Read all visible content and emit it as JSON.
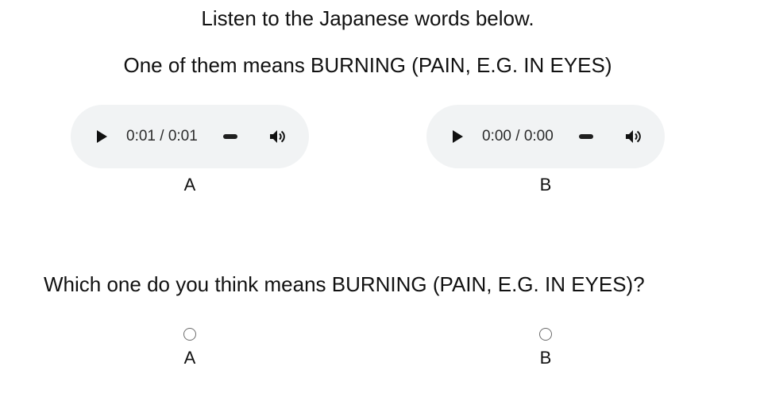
{
  "instructions": {
    "intro": "Listen to the Japanese words below.",
    "prompt": "One of them means BURNING (PAIN, E.G. IN EYES)"
  },
  "audio_players": [
    {
      "time": "0:01 / 0:01",
      "label": "A",
      "icons": [
        "play-icon",
        "volume-icon"
      ]
    },
    {
      "time": "0:00 / 0:00",
      "label": "B",
      "icons": [
        "play-icon",
        "volume-icon"
      ]
    }
  ],
  "question": {
    "text": "Which one do you think means BURNING (PAIN, E.G. IN EYES)?",
    "options": [
      {
        "label": "A",
        "selected": false
      },
      {
        "label": "B",
        "selected": false
      }
    ]
  },
  "colors": {
    "player_background": "#f1f3f4",
    "text": "#111111"
  }
}
